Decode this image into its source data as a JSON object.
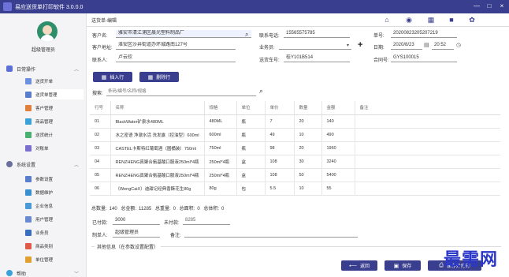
{
  "window": {
    "title": "易应送货单打印软件 3.0.0.0",
    "controls": [
      "—",
      "□",
      "×"
    ]
  },
  "sidebar": {
    "user": "超级管理员",
    "groups": [
      {
        "label": "日常操作",
        "icon": "clipboard-icon"
      },
      {
        "label": "系统设置",
        "icon": "gear-icon"
      },
      {
        "label": "帮助",
        "icon": "help-icon"
      }
    ],
    "items": [
      {
        "label": "送货开单",
        "icon": "edit-doc-icon"
      },
      {
        "label": "送货单管理",
        "icon": "list-doc-icon"
      },
      {
        "label": "客户管理",
        "icon": "customer-icon"
      },
      {
        "label": "商品管理",
        "icon": "goods-icon"
      },
      {
        "label": "送货统计",
        "icon": "stats-icon"
      },
      {
        "label": "对账单",
        "icon": "statement-icon"
      },
      {
        "label": "参数设置",
        "icon": "params-icon"
      },
      {
        "label": "数据维护",
        "icon": "database-icon"
      },
      {
        "label": "企业信息",
        "icon": "company-icon"
      },
      {
        "label": "用户管理",
        "icon": "user-icon"
      },
      {
        "label": "业务员",
        "icon": "salesman-icon"
      },
      {
        "label": "商品类别",
        "icon": "category-icon"
      },
      {
        "label": "单位管理",
        "icon": "unit-icon"
      }
    ]
  },
  "tab": {
    "label": "送货单-编辑"
  },
  "form": {
    "customer_name_label": "客户名:",
    "customer_name": "雅安市清江浦区晨光塑料制品厂",
    "contact_phone_label": "联系电话:",
    "contact_phone": "15565575785",
    "order_no_label": "单号:",
    "order_no": "20200823205207219",
    "address_label": "客户地址:",
    "address": "淮安区沙井街道办环城路南127号",
    "salesman_label": "业务员:",
    "salesman": "",
    "date_label": "日期:",
    "date": "2020/8/23",
    "time": "20:52",
    "contact_label": "联系人:",
    "contact": "卢云钦",
    "vehicle_label": "送货车号:",
    "vehicle": "桂Y101B514",
    "contract_label": "合同号:",
    "contract": "GYS100015"
  },
  "actions": {
    "insert_row": "插入行",
    "delete_row": "删除行",
    "search_label": "搜索:",
    "search_placeholder": "条码/编号/名称/规格"
  },
  "table": {
    "headers": [
      "行号",
      "名称",
      "规格",
      "单位",
      "单价",
      "数量",
      "金额",
      "备注"
    ],
    "rows": [
      [
        "01",
        "BlackWater矿泉水480ML",
        "480ML",
        "瓶",
        "7",
        "20",
        "140",
        ""
      ],
      [
        "02",
        "水之密语 净澈水活 洗发露（控油型）600ml",
        "600ml",
        "瓶",
        "49",
        "10",
        "490",
        ""
      ],
      [
        "03",
        "CASTEL卡斯特红葡萄酒（圆桶装）750ml",
        "750ml",
        "瓶",
        "98",
        "20",
        "1960",
        ""
      ],
      [
        "04",
        "RENZHENG真聚合氨基酸口服液250ml*4瓶",
        "250ml*4瓶",
        "盒",
        "108",
        "30",
        "3240",
        ""
      ],
      [
        "05",
        "RENZHENG真聚合氨基酸口服液250ml*4瓶",
        "250ml*4瓶",
        "盒",
        "108",
        "50",
        "5400",
        ""
      ],
      [
        "06",
        "（WengCaiX）迪甜记经典香酥花生80g",
        "80g",
        "包",
        "5.5",
        "10",
        "55",
        ""
      ]
    ]
  },
  "summary": {
    "count_label": "总数量:",
    "count": "140",
    "amount_label": "总金额:",
    "amount": "11285",
    "weight_label": "总重量:",
    "weight": "0",
    "area_label": "总面积:",
    "area": "0",
    "volume_label": "总体积:",
    "volume": "0",
    "paid_label": "已付款:",
    "paid": "3000",
    "unpaid_label": "未付款:",
    "unpaid": "8285",
    "maker_label": "制单人:",
    "maker": "超级管理员",
    "remark_label": "备注:",
    "remark": "",
    "other_info": "其他信息（在参数设置配置）"
  },
  "footer": {
    "back": "返回",
    "save": "保存",
    "save_print": "保存并打印"
  },
  "watermark": "最需网",
  "colors": {
    "accent": "#3a3e8e",
    "titlebar": "#3a3e8e"
  }
}
